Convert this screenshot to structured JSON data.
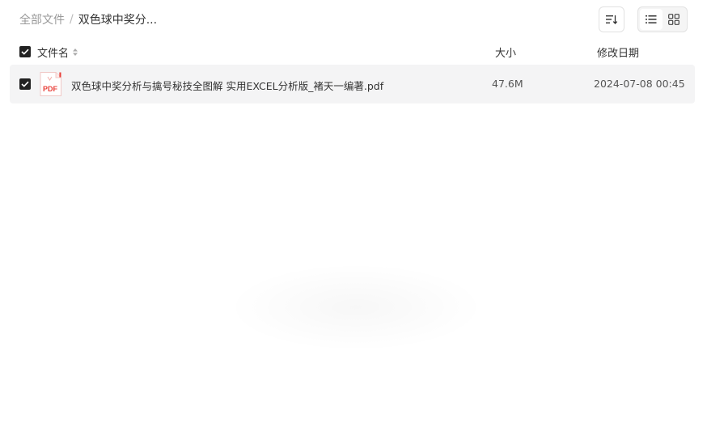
{
  "breadcrumb": {
    "root": "全部文件",
    "separator": "/",
    "current": "双色球中奖分..."
  },
  "toolbar": {
    "sort_icon": "sort-icon",
    "views": [
      {
        "icon": "list-view-icon",
        "active": true
      },
      {
        "icon": "grid-view-icon",
        "active": false
      }
    ]
  },
  "table": {
    "headers": {
      "name": "文件名",
      "size": "大小",
      "date": "修改日期"
    },
    "rows": [
      {
        "icon": "pdf-file-icon",
        "icon_text": "PDF",
        "name": "双色球中奖分析与擒号秘技全图解 实用EXCEL分析版_褚天一编著.pdf",
        "size": "47.6M",
        "date": "2024-07-08 00:45",
        "checked": true
      }
    ]
  },
  "colors": {
    "pdf_red": "#e8403a",
    "row_bg": "#f4f4f5",
    "checkbox": "#222222"
  }
}
